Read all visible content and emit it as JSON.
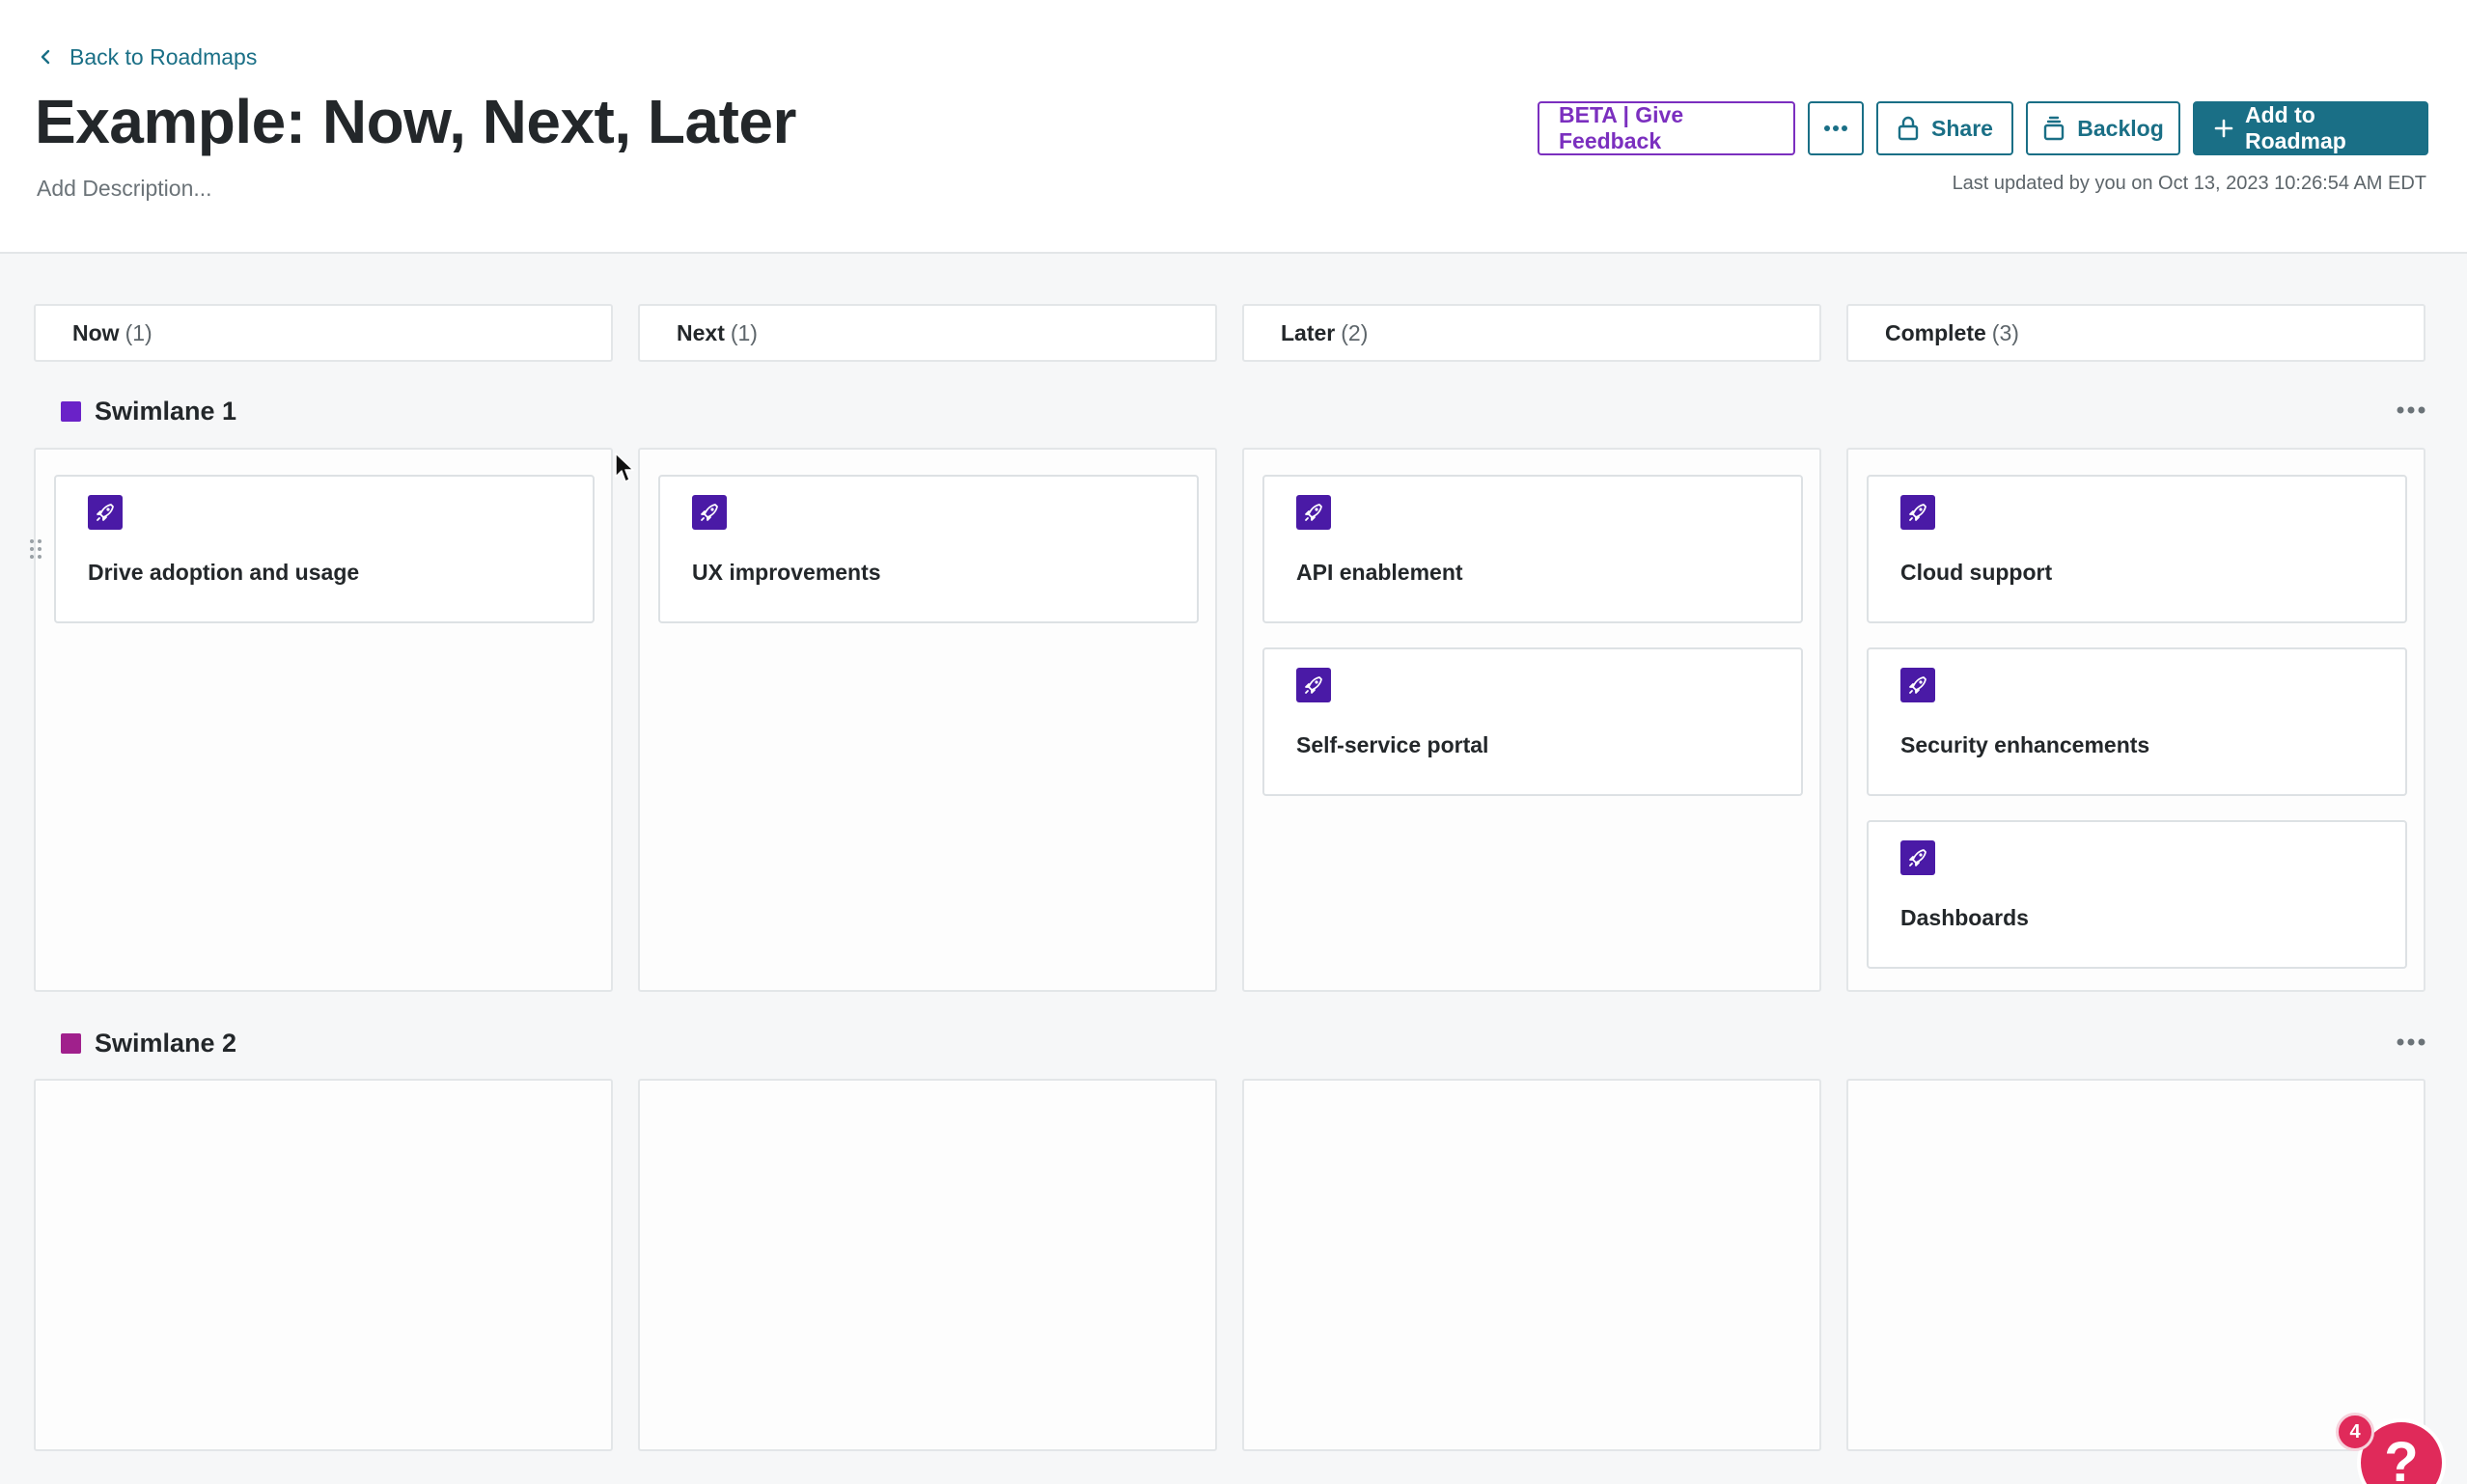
{
  "header": {
    "back_label": "Back to Roadmaps",
    "title": "Example: Now, Next, Later",
    "description_placeholder": "Add Description...",
    "last_updated": "Last updated by you on Oct 13, 2023 10:26:54 AM EDT",
    "actions": {
      "beta_label": "BETA | Give Feedback",
      "share_label": "Share",
      "backlog_label": "Backlog",
      "add_label": "Add to Roadmap"
    }
  },
  "columns": [
    {
      "label": "Now",
      "count": "(1)"
    },
    {
      "label": "Next",
      "count": "(1)"
    },
    {
      "label": "Later",
      "count": "(2)"
    },
    {
      "label": "Complete",
      "count": "(3)"
    }
  ],
  "swimlanes": [
    {
      "title": "Swimlane 1",
      "color": "#6a22c8"
    },
    {
      "title": "Swimlane 2",
      "color": "#a0208c"
    }
  ],
  "cards": {
    "now": [
      "Drive adoption and usage"
    ],
    "next": [
      "UX improvements"
    ],
    "later": [
      "API enablement",
      "Self-service portal"
    ],
    "complete": [
      "Cloud support",
      "Security enhancements",
      "Dashboards"
    ]
  },
  "card_icon": "rocket-icon",
  "help": {
    "badge_count": "4",
    "glyph": "?"
  },
  "colors": {
    "accent": "#1a6f86",
    "beta": "#7b2fbf",
    "card_icon_bg": "#4a1aa6",
    "help": "#e02a5a"
  }
}
